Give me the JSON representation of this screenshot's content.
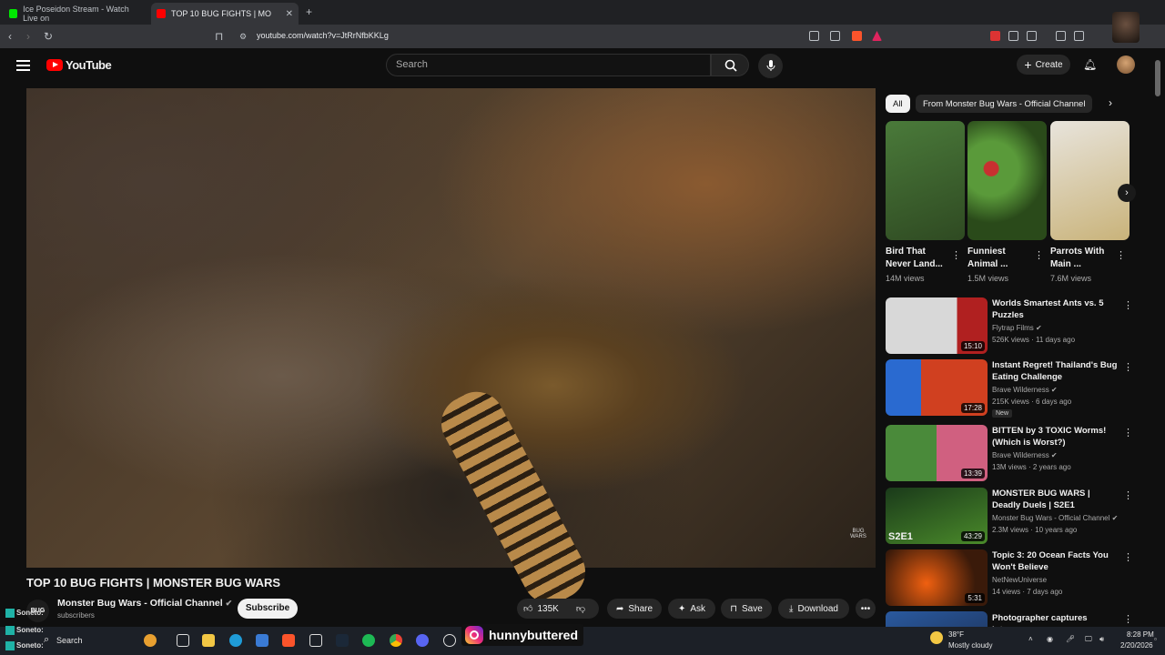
{
  "browser": {
    "tabs": [
      {
        "title": "Ice Poseidon Stream - Watch Live on",
        "color": "#00e701"
      },
      {
        "title": "TOP 10 BUG FIGHTS | MONST",
        "color": "#ff0000"
      }
    ],
    "new_tab": "+",
    "url": "youtube.com/watch?v=JtRrNfbKKLg"
  },
  "youtube": {
    "logo_text": "YouTube",
    "search_placeholder": "Search",
    "create_label": "Create"
  },
  "video": {
    "title": "TOP 10 BUG FIGHTS | MONSTER BUG WARS",
    "channel": "Monster Bug Wars - Official Channel",
    "channel_avatar_text": "BUG",
    "subscribers": "subscribers",
    "subscribe_label": "Subscribe",
    "likes": "135K",
    "share_label": "Share",
    "ask_label": "Ask",
    "save_label": "Save",
    "download_label": "Download",
    "watermark": "BUG WARS"
  },
  "chips": {
    "all": "All",
    "channel": "From Monster Bug Wars - Official Channel"
  },
  "shorts": [
    {
      "title": "Bird That Never Land...",
      "views": "14M views",
      "colors": [
        "#4a7a3a",
        "#2f4a22"
      ]
    },
    {
      "title": "Funniest Animal ...",
      "views": "1.5M views",
      "colors": [
        "#5a9a3a",
        "#c83030"
      ]
    },
    {
      "title": "Parrots With Main ...",
      "views": "7.6M views",
      "colors": [
        "#e8e4dc",
        "#c9b37a"
      ]
    }
  ],
  "recommendations": [
    {
      "title": "Worlds Smartest Ants vs. 5 Puzzles",
      "channel": "Flytrap Films",
      "meta": "526K views · 11 days ago",
      "duration": "15:10",
      "new": "",
      "colors": [
        "#d8d8d8",
        "#b02020"
      ]
    },
    {
      "title": "Instant Regret! Thailand's Bug Eating Challenge",
      "channel": "Brave Wilderness",
      "meta": "215K views · 6 days ago",
      "duration": "17:28",
      "new": "New",
      "colors": [
        "#2a6ad0",
        "#d04020"
      ]
    },
    {
      "title": "BITTEN by 3 TOXIC Worms! (Which is Worst?)",
      "channel": "Brave Wilderness",
      "meta": "13M views · 2 years ago",
      "duration": "13:39",
      "new": "",
      "colors": [
        "#4a8a3a",
        "#d06080"
      ]
    },
    {
      "title": "MONSTER BUG WARS | Deadly Duels | S2E1",
      "channel": "Monster Bug Wars - Official Channel",
      "meta": "2.3M views · 10 years ago",
      "duration": "43:29",
      "new": "",
      "colors": [
        "#1a3a1a",
        "#4a8a2a"
      ]
    },
    {
      "title": "Topic 3: 20 Ocean Facts You Won't Believe",
      "channel": "NetNewUniverse",
      "meta": "14 views · 7 days ago",
      "duration": "5:31",
      "new": "",
      "colors": [
        "#d04010",
        "#3a1a0a"
      ]
    },
    {
      "title": "Photographer captures intense",
      "channel": "",
      "meta": "",
      "duration": "",
      "new": "",
      "colors": [
        "#2a5aa0",
        "#1a2a4a"
      ]
    }
  ],
  "thumb_text": {
    "s2e1": "S2E1"
  },
  "taskbar": {
    "search": "Search",
    "weather_temp": "38°F",
    "weather_desc": "Mostly cloudy",
    "time": "8:28 PM",
    "date": "2/20/2026"
  },
  "overlay": {
    "handle": "hunnybuttered",
    "chat_name": "Soneto:"
  }
}
